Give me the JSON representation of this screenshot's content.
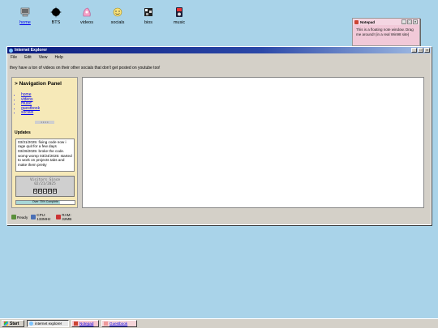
{
  "desktop": {
    "icons": [
      {
        "label": "home",
        "icon": "computer-icon"
      },
      {
        "label": "BTS",
        "icon": "star-icon"
      },
      {
        "label": "videos",
        "icon": "video-icon"
      },
      {
        "label": "socials",
        "icon": "smiley-icon"
      },
      {
        "label": "bios",
        "icon": "bios-icon"
      },
      {
        "label": "music",
        "icon": "ipod-icon"
      }
    ]
  },
  "notepad": {
    "title": "Notepad",
    "body": "This is a floating note window. Drag me around! (in a real Win98 site)"
  },
  "ie": {
    "title": "Internet Explorer",
    "menu": [
      "File",
      "Edit",
      "View",
      "Help"
    ],
    "tagline": "they have a ton of videos on their other socials that don't get posted on youtube too!",
    "nav": {
      "title": "> Navigation Panel",
      "links": [
        "home",
        "videos",
        "music",
        "guestbook",
        "socials"
      ],
      "dots": "• • • •"
    },
    "updates": {
      "title": "Updates",
      "text": "03/31/2025: fixing code now i rage quit for a few days 03/26/2025: broke the code. womp womp 03/24/2025: started to work on projects tabs and make them pretty"
    },
    "visitors": {
      "label": "Visitors Since",
      "date": "02/21/2025",
      "digits": [
        "0",
        "0",
        "2",
        "0",
        "8"
      ]
    },
    "progress": {
      "text": "Over 75% Complete",
      "value": 0.75
    },
    "status": {
      "ready": "Ready",
      "cpu": "CPU: 133MHz",
      "ram": "RAM: 32MB"
    }
  },
  "taskbar": {
    "start": "Start",
    "tasks": [
      "internet explorer",
      "Notepad",
      "Guestbook"
    ]
  },
  "colors": {
    "desktop": "#a9d3e9",
    "titlebar": "#0b1b7e",
    "panel": "#f6e9b8",
    "notepad": "#f1c9d8"
  }
}
